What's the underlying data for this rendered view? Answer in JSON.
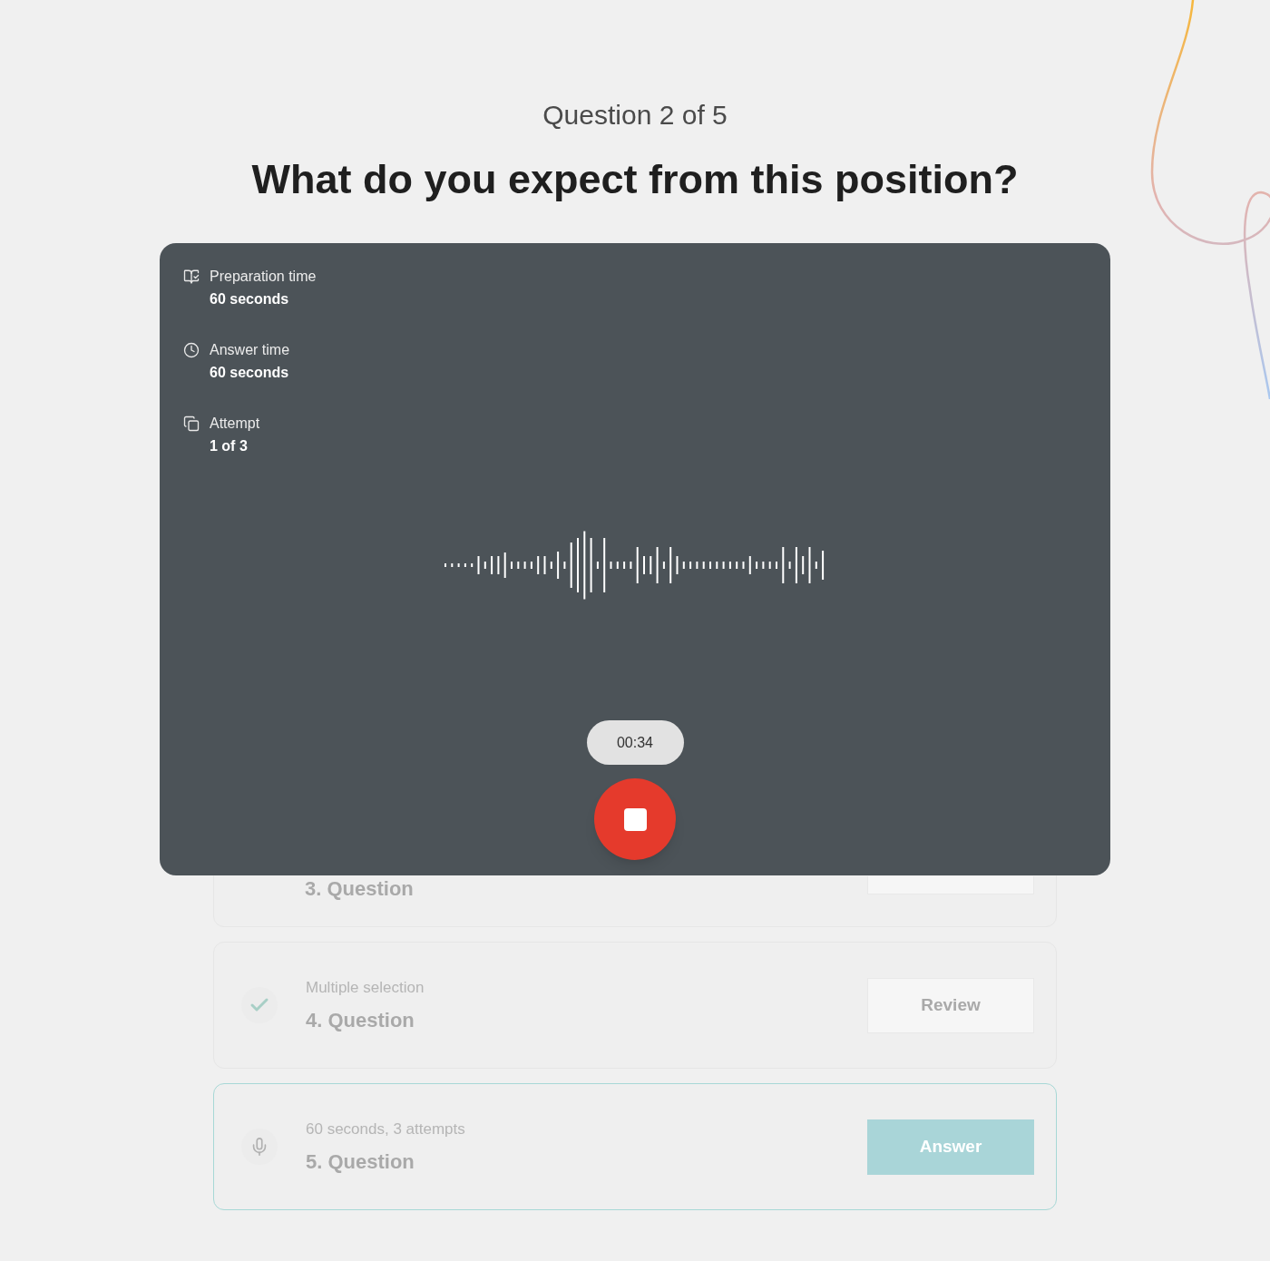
{
  "header": {
    "progress": "Question 2 of 5",
    "question": "What do you expect from this position?"
  },
  "recorder": {
    "info": [
      {
        "kind": "preparation",
        "label": "Preparation time",
        "value": "60 seconds"
      },
      {
        "kind": "answer",
        "label": "Answer time",
        "value": "60 seconds"
      },
      {
        "kind": "attempt",
        "label": "Attempt",
        "value": "1 of 3"
      }
    ],
    "timer": "00:34",
    "recording": true
  },
  "questions": [
    {
      "kind": "partial",
      "title": "3. Question",
      "selected": false
    },
    {
      "kind": "done",
      "subtitle": "Multiple selection",
      "title": "4. Question",
      "action": "Review",
      "selected": false
    },
    {
      "kind": "audio",
      "subtitle": "60 seconds, 3 attempts",
      "title": "5. Question",
      "action": "Answer",
      "selected": true
    }
  ]
}
